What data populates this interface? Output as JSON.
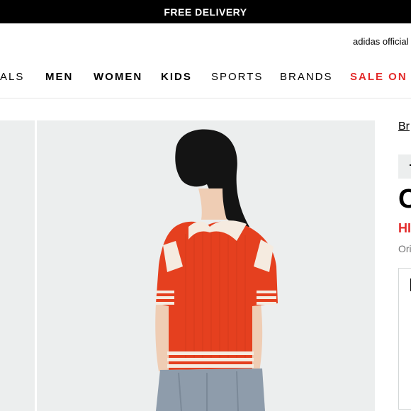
{
  "promo": {
    "text": "FREE DELIVERY"
  },
  "utility": {
    "official_text": "adidas official"
  },
  "nav": {
    "items": [
      {
        "label": "ALS",
        "style": "normal"
      },
      {
        "label": "MEN",
        "style": "bold"
      },
      {
        "label": "WOMEN",
        "style": "bold"
      },
      {
        "label": "KIDS",
        "style": "bold"
      },
      {
        "label": "SPORTS",
        "style": "normal"
      },
      {
        "label": "BRANDS",
        "style": "normal"
      },
      {
        "label": "SALE ON S",
        "style": "sale"
      }
    ]
  },
  "product": {
    "breadcrumb": "Br",
    "title": "C",
    "price": "HI",
    "original_price": "Ori",
    "image_alt": "model wearing red knit polo with white stripes and denim jeans, back view"
  },
  "colors": {
    "sale_red": "#e32b2b",
    "shirt_red": "#e5401f",
    "cream": "#f5ebe0",
    "bg_gray": "#eceeee"
  }
}
